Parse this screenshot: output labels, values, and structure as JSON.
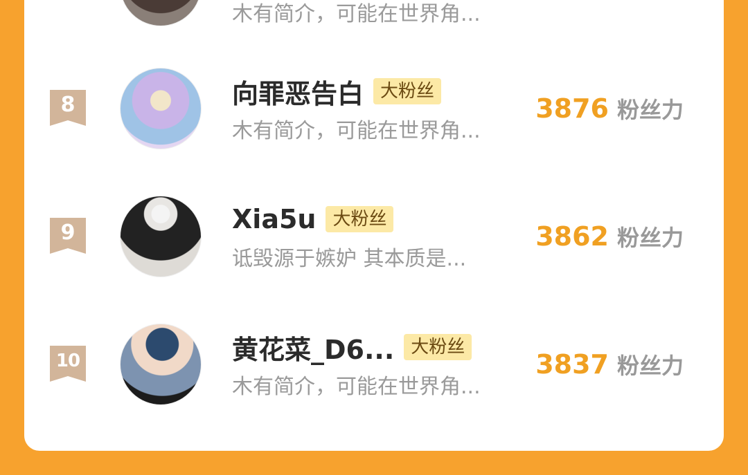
{
  "badge_label": "大粉丝",
  "score_unit": "粉丝力",
  "partial_top": {
    "bio": "木有简介，可能在世界角..."
  },
  "rows": [
    {
      "rank": "8",
      "name": "向罪恶告白",
      "bio": "木有简介，可能在世界角...",
      "score": "3876"
    },
    {
      "rank": "9",
      "name": "Xia5u",
      "bio": "诋毁源于嫉妒 其本质是...",
      "score": "3862"
    },
    {
      "rank": "10",
      "name": "黄花菜_D6...",
      "bio": "木有简介，可能在世界角...",
      "score": "3837"
    }
  ]
}
